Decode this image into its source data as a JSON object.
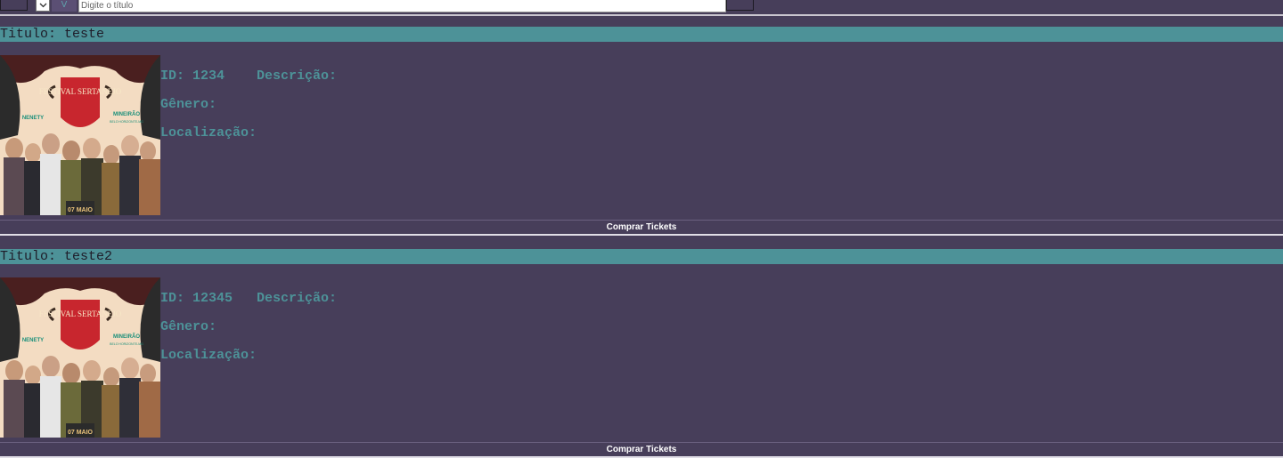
{
  "search": {
    "select_value": "",
    "toggle_label": "V",
    "placeholder": "Digite o título",
    "value": ""
  },
  "events": [
    {
      "title_prefix": "Titulo:",
      "title": "teste",
      "id_label": "ID:",
      "id": "1234",
      "description_label": "Descrição:",
      "description": "",
      "genre_label": "Gênero:",
      "genre": "",
      "location_label": "Localização:",
      "location": "",
      "buy_label": "Comprar Tickets",
      "poster": {
        "festival_text": "FESTIVAL SERTANEJO",
        "left_tag": "NENETY",
        "right_tag": "MINEIRÃO",
        "right_sub": "BELO HORIZONTE-MG",
        "bottom_tag": "07 MAIO"
      }
    },
    {
      "title_prefix": "Titulo:",
      "title": "teste2",
      "id_label": "ID:",
      "id": "12345",
      "description_label": "Descrição:",
      "description": "",
      "genre_label": "Gênero:",
      "genre": "",
      "location_label": "Localização:",
      "location": "",
      "buy_label": "Comprar Tickets",
      "poster": {
        "festival_text": "FESTIVAL SERTANEJO",
        "left_tag": "NENETY",
        "right_tag": "MINEIRÃO",
        "right_sub": "BELO HORIZONTE-MG",
        "bottom_tag": "07 MAIO"
      }
    }
  ],
  "colors": {
    "background": "#473e5a",
    "accent": "#4d9298",
    "button_text": "#ffffff"
  }
}
